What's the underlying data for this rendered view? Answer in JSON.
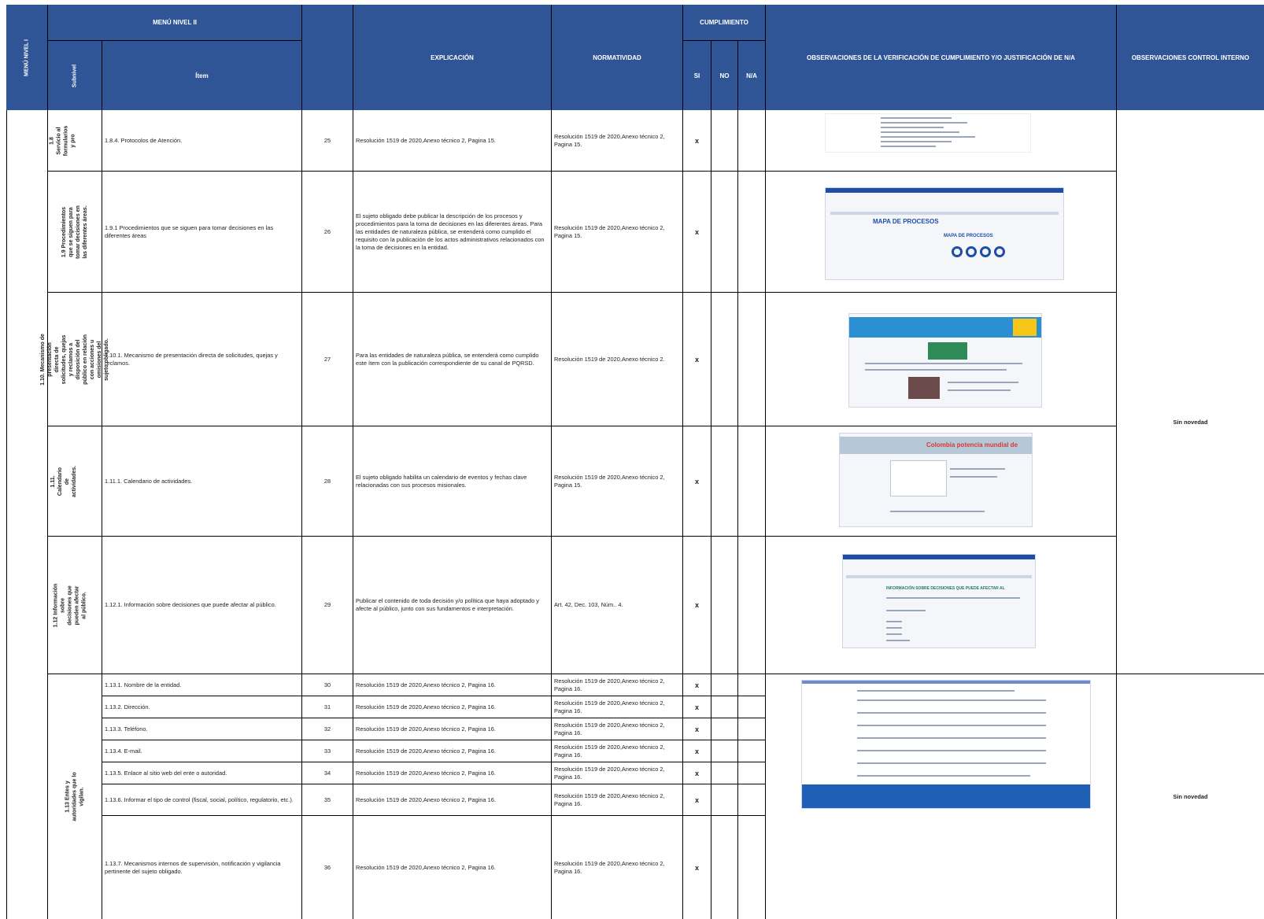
{
  "header": {
    "menu_nivel_1": "MENÚ NIVEL I",
    "menu_nivel_2": "MENÚ NIVEL II",
    "subnivel": "Subnivel",
    "item": "Ítem",
    "explicacion": "EXPLICACIÓN",
    "normatividad": "NORMATIVIDAD",
    "cumplimiento": "CUMPLIMIENTO",
    "si": "SI",
    "no": "NO",
    "na": "N/A",
    "observaciones": "OBSERVACIONES DE LA VERIFICACIÓN DE CUMPLIMIENTO Y/O JUSTIFICACIÓN DE N/A",
    "control_interno": "OBSERVACIONES CONTROL INTERNO"
  },
  "subnivels": [
    "1.8 Servicio al formularios y pro",
    "1.9 Procedimientos que se siguen para tomar decisiones en las diferentes áreas.",
    "1.10. Mecanismo de presentación directa de solicitudes, quejas y reclamos a disposición del público en relación con acciones u omisiones del sujeto obligado.",
    "1.11. Calendario de actividades.",
    "1.12 Información sobre decisiones que pueden afectar al público.",
    "1.13 Entes y autoridades que lo vigilan."
  ],
  "rows": [
    {
      "item": "1.8.4. Protocolos de Atención.",
      "num": "25",
      "explicacion": "Resolución 1519 de 2020,Anexo técnico 2, Pagina 15.",
      "normatividad": "Resolución 1519 de 2020,Anexo técnico 2, Pagina 15.",
      "si": "x"
    },
    {
      "item": "1.9.1 Procedimientos que se siguen para tomar decisiones en las diferentes áreas",
      "num": "26",
      "explicacion": "El sujeto obligado debe publicar la descripción de los procesos y procedimientos para la toma de decisiones en las diferentes áreas.  Para las entidades de naturaleza pública, se entenderá como cumplido el requisito con la publicación de los actos administrativos relacionados con la toma de decisiones en la entidad.",
      "normatividad": "Resolución 1519 de 2020,Anexo técnico 2, Pagina 15.",
      "si": "x"
    },
    {
      "item": "1.10.1. Mecanismo de presentación directa de solicitudes, quejas y reclamos.",
      "num": "27",
      "explicacion": "Para las entidades de naturaleza pública, se entenderá como cumplido este ítem con la publicación correspondiente de su canal de PQRSD.",
      "normatividad": "Resolución 1519 de 2020,Anexo técnico 2.",
      "si": "x"
    },
    {
      "item": "1.11.1. Calendario de actividades.",
      "num": "28",
      "explicacion": "El sujeto obligado habilita un calendario de eventos y fechas clave relacionadas con sus procesos misionales.",
      "normatividad": "Resolución 1519 de 2020,Anexo técnico 2, Pagina 15.",
      "si": "x"
    },
    {
      "item": "1.12.1.  Información sobre decisiones que puede afectar al público.",
      "num": "29",
      "explicacion": "Publicar el contenido de toda decisión y/o política que haya adoptado y afecte al público, junto con sus fundamentos e interpretación.",
      "normatividad": "Art. 42, Dec. 103, Núm.. 4.",
      "si": "x"
    },
    {
      "item": "1.13.1. Nombre de la entidad.",
      "num": "30",
      "explicacion": "Resolución 1519 de 2020,Anexo técnico 2, Pagina 16.",
      "normatividad": "Resolución 1519 de 2020,Anexo técnico 2, Pagina 16.",
      "si": "x"
    },
    {
      "item": "1.13.2. Dirección.",
      "num": "31",
      "explicacion": "Resolución 1519 de 2020,Anexo técnico 2, Pagina 16.",
      "normatividad": "Resolución 1519 de 2020,Anexo técnico 2, Pagina 16.",
      "si": "x"
    },
    {
      "item": "1.13.3. Teléfono.",
      "num": "32",
      "explicacion": "Resolución 1519 de 2020,Anexo técnico 2, Pagina 16.",
      "normatividad": "Resolución 1519 de 2020,Anexo técnico 2, Pagina 16.",
      "si": "x"
    },
    {
      "item": "1.13.4. E-mail.",
      "num": "33",
      "explicacion": "Resolución 1519 de 2020,Anexo técnico 2, Pagina 16.",
      "normatividad": "Resolución 1519 de 2020,Anexo técnico 2, Pagina 16.",
      "si": "x"
    },
    {
      "item": "1.13.5.  Enlace al sitio web del ente o autoridad.",
      "num": "34",
      "explicacion": "Resolución 1519 de 2020,Anexo técnico 2, Pagina 16.",
      "normatividad": "Resolución 1519 de 2020,Anexo técnico 2, Pagina 16.",
      "si": "x"
    },
    {
      "item": "1.13.6.  Informar el tipo de control  (fiscal, social, político, regulatorio, etc.).",
      "num": "35",
      "explicacion": "Resolución 1519 de 2020,Anexo técnico 2, Pagina 16.",
      "normatividad": "Resolución 1519 de 2020,Anexo técnico 2, Pagina 16.",
      "si": "x"
    },
    {
      "item": "1.13.7. Mecanismos internos de supervisión, notificación y vigilancia pertinente del sujeto obligado.",
      "num": "36",
      "explicacion": "Resolución 1519 de 2020,Anexo técnico 2, Pagina 16.",
      "normatividad": "Resolución 1519 de 2020,Anexo técnico 2, Pagina 16.",
      "si": "x"
    }
  ],
  "control_interno": [
    "Sin novedad",
    "Sin novedad"
  ],
  "screenshots": {
    "mapa_title": "MAPA DE PROCESOS",
    "mapa_inner_title": "MAPA DE PROCESOS",
    "calendario_banner": "Colombia potencia mundial de",
    "info_title": "INFORMACIÓN SOBRE DECISIONES QUE PUEDE AFECTAR AL"
  },
  "colors": {
    "header_bg": "#2f5597",
    "header_text": "#ffffff"
  }
}
